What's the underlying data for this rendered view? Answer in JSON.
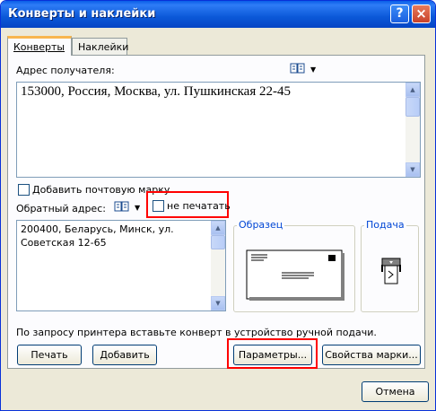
{
  "window": {
    "title": "Конверты и наклейки",
    "help": "?",
    "close": "×"
  },
  "tabs": [
    {
      "label": "Конверты"
    },
    {
      "label": "Наклейки"
    }
  ],
  "recipient": {
    "label": "Адрес получателя:",
    "value": "153000, Россия, Москва, ул. Пушкинская 22-45"
  },
  "add_stamp": {
    "label": "Добавить почтовую марку"
  },
  "return_address": {
    "label": "Обратный адрес:",
    "value_line1": "200400, Беларусь, Минск, ул.",
    "value_line2": "Советская 12-65"
  },
  "no_print": {
    "label": "не печатать"
  },
  "preview": {
    "label": "Образец"
  },
  "feed": {
    "label": "Подача"
  },
  "info_text": "По запросу принтера вставьте конверт в устройство ручной подачи.",
  "buttons": {
    "print": "Печать",
    "add": "Добавить",
    "options": "Параметры...",
    "stamp_props": "Свойства марки...",
    "cancel": "Отмена"
  },
  "icons": {
    "address_book": "address-book-icon",
    "dropdown": "chevron-down-icon"
  },
  "colors": {
    "highlight": "#ff0000",
    "title_bar": "#0a5ee8"
  }
}
